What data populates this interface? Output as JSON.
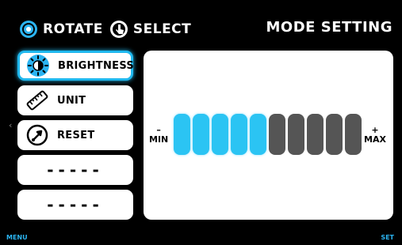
{
  "header": {
    "rotate_label": "ROTATE",
    "select_label": "SELECT",
    "title": "MODE SETTING"
  },
  "menu": {
    "items": [
      {
        "label": "BRIGHTNESS",
        "icon": "brightness-icon",
        "active": true
      },
      {
        "label": "UNIT",
        "icon": "ruler-icon",
        "active": false
      },
      {
        "label": "RESET",
        "icon": "reset-icon",
        "active": false
      },
      {
        "label": "-----",
        "icon": "",
        "active": false
      },
      {
        "label": "-----",
        "icon": "",
        "active": false
      }
    ]
  },
  "level": {
    "min_label": "MIN",
    "max_label": "MAX",
    "min_symbol": "–",
    "max_symbol": "+",
    "total_segments": 10,
    "filled_segments": 5
  },
  "footer": {
    "left_label": "MENU",
    "right_label": "SET"
  },
  "colors": {
    "accent": "#2bc4f3",
    "inactive_segment": "#555555",
    "background": "#000000"
  }
}
